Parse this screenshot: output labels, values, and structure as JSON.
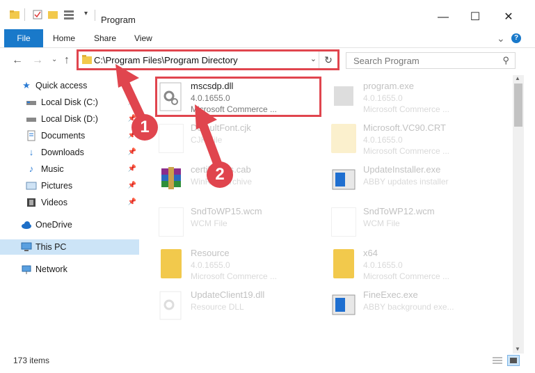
{
  "window": {
    "title": "Program",
    "minimize": "—",
    "maximize": "☐",
    "close": "✕"
  },
  "ribbon": {
    "tabs": [
      "File",
      "Home",
      "Share",
      "View"
    ],
    "expand": "⌄",
    "help": "?"
  },
  "address": {
    "path": "C:\\Program Files\\Program Directory",
    "refresh": "↻",
    "dropdown": "⌄"
  },
  "search": {
    "placeholder": "Search Program"
  },
  "sidebar": {
    "items": [
      {
        "label": "Quick access",
        "icon": "star-icon"
      },
      {
        "label": "Local Disk (C:)",
        "icon": "drive-icon"
      },
      {
        "label": "Local Disk (D:)",
        "icon": "drive-icon"
      },
      {
        "label": "Documents",
        "icon": "documents-icon"
      },
      {
        "label": "Downloads",
        "icon": "downloads-icon"
      },
      {
        "label": "Music",
        "icon": "music-icon"
      },
      {
        "label": "Pictures",
        "icon": "pictures-icon"
      },
      {
        "label": "Videos",
        "icon": "videos-icon"
      },
      {
        "label": "OneDrive",
        "icon": "cloud-icon"
      },
      {
        "label": "This PC",
        "icon": "computer-icon"
      },
      {
        "label": "Network",
        "icon": "network-icon"
      }
    ]
  },
  "files": [
    {
      "name": "mscsdp.dll",
      "line2": "4.0.1655.0",
      "line3": "Microsoft Commerce ..."
    },
    {
      "name": "program.exe",
      "line2": "4.0.1655.0",
      "line3": "Microsoft Commerce ..."
    },
    {
      "name": "DefaultFont.cjk",
      "line2": "CJK File",
      "line3": ""
    },
    {
      "name": "Microsoft.VC90.CRT",
      "line2": "4.0.1655.0",
      "line3": "Microsoft Commerce ..."
    },
    {
      "name": "certificates.cab",
      "line2": "WinRAR archive",
      "line3": ""
    },
    {
      "name": "UpdateInstaller.exe",
      "line2": "ABBY updates installer",
      "line3": ""
    },
    {
      "name": "SndToWP15.wcm",
      "line2": "WCM File",
      "line3": ""
    },
    {
      "name": "SndToWP12.wcm",
      "line2": "WCM File",
      "line3": ""
    },
    {
      "name": "Resource",
      "line2": "4.0.1655.0",
      "line3": "Microsoft Commerce ..."
    },
    {
      "name": "x64",
      "line2": "4.0.1655.0",
      "line3": "Microsoft Commerce ..."
    },
    {
      "name": "UpdateClient19.dll",
      "line2": "Resource DLL",
      "line3": ""
    },
    {
      "name": "FineExec.exe",
      "line2": "ABBY background exe...",
      "line3": ""
    }
  ],
  "status": {
    "count": "173 items"
  },
  "annotations": {
    "badge1": "1",
    "badge2": "2",
    "color": "#e0454e"
  }
}
